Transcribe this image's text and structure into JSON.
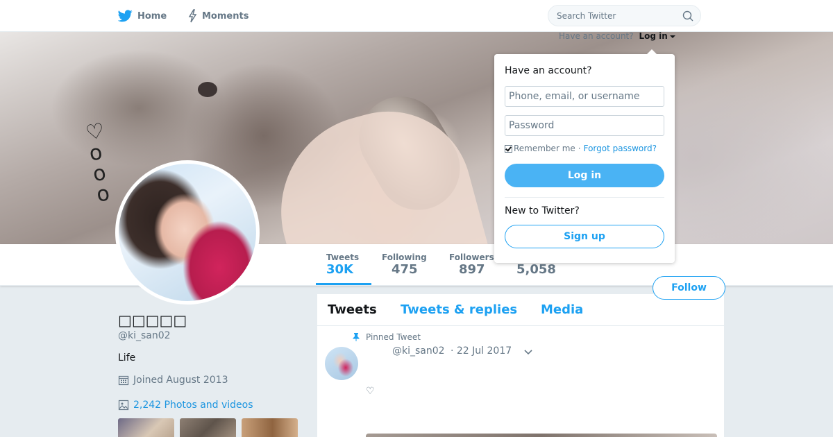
{
  "nav": {
    "home_label": "Home",
    "moments_label": "Moments",
    "search_placeholder": "Search Twitter"
  },
  "login_hint": {
    "text": "Have an account?",
    "link": "Log in"
  },
  "profile_stats": [
    {
      "label": "Tweets",
      "value": "30K",
      "active": true
    },
    {
      "label": "Following",
      "value": "475"
    },
    {
      "label": "Followers",
      "value": "897"
    },
    {
      "label": "",
      "value": "5,058"
    }
  ],
  "follow_button": "Follow",
  "profile": {
    "name": "□□□□□",
    "handle": "@ki_san02",
    "bio": "Life",
    "joined": "Joined August 2013",
    "photos": "2,242 Photos and videos"
  },
  "timeline": {
    "tabs": [
      "Tweets",
      "Tweets & replies",
      "Media"
    ],
    "pinned_label": "Pinned Tweet",
    "tweet": {
      "handle": "@ki_san02",
      "date": "· 22 Jul 2017",
      "text": "♡"
    }
  },
  "login_box": {
    "heading": "Have an account?",
    "username_placeholder": "Phone, email, or username",
    "password_placeholder": "Password",
    "remember": "Remember me",
    "separator": "·",
    "forgot": "Forgot password?",
    "login_button": "Log in",
    "new_text": "New to Twitter?",
    "signup_button": "Sign up"
  },
  "colors": {
    "accent": "#1da1f2",
    "login_button": "#4ab3f4",
    "background": "#e6ecf0"
  },
  "icons": [
    "twitter-bird-icon",
    "lightning-icon",
    "search-icon",
    "pin-icon",
    "calendar-icon",
    "image-icon",
    "chevron-down-icon"
  ]
}
